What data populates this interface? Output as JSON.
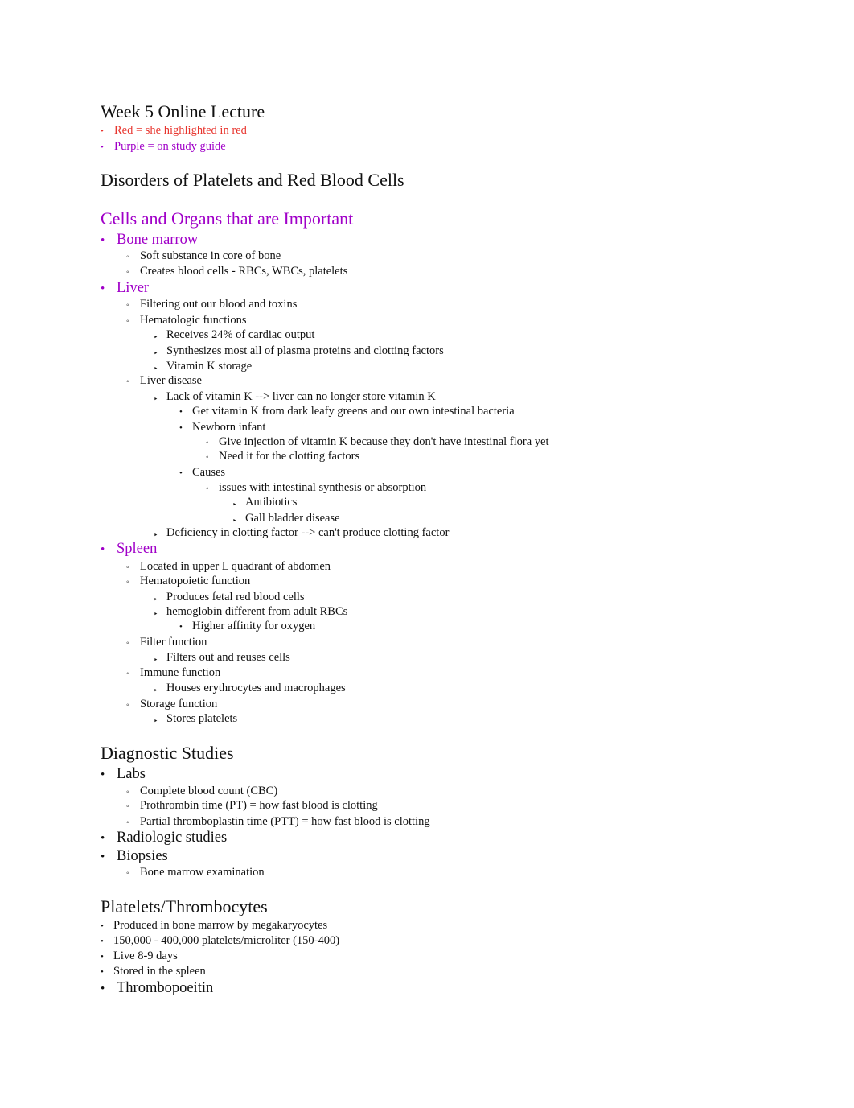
{
  "colors": {
    "red": "#e8352e",
    "purple": "#a000c8",
    "text": "#111111"
  },
  "title": "Week 5 Online Lecture",
  "legend": [
    {
      "text": "Red = she highlighted in red",
      "color": "red"
    },
    {
      "text": "Purple = on study guide",
      "color": "purple"
    }
  ],
  "section1": {
    "title": "Disorders of Platelets and Red Blood Cells"
  },
  "section2": {
    "title": "Cells and Organs that are Important",
    "lines": [
      "Bone marrow",
      "Soft substance in core of bone",
      "Creates blood cells - RBCs, WBCs, platelets",
      "Liver",
      "Filtering out our blood and toxins",
      "Hematologic functions",
      "Receives 24% of cardiac output",
      "Synthesizes most all of plasma proteins and clotting factors",
      "Vitamin K storage",
      "Liver disease",
      "Lack of vitamin K --> liver can no longer store vitamin K",
      "Get vitamin K from dark leafy greens and our own intestinal bacteria",
      "Newborn infant",
      "Give injection of vitamin K because they don't have intestinal flora yet",
      "Need it for the clotting factors",
      "Causes",
      "issues with intestinal synthesis or absorption",
      "Antibiotics",
      "Gall bladder disease",
      "Deficiency in clotting factor --> can't produce clotting factor",
      "Spleen",
      "Located in upper L quadrant of abdomen",
      "Hematopoietic function",
      "Produces fetal red blood cells",
      "hemoglobin different from adult RBCs",
      "Higher affinity for oxygen",
      "Filter function",
      "Filters out and reuses cells",
      "Immune function",
      "Houses erythrocytes and macrophages",
      "Storage function",
      "Stores platelets"
    ]
  },
  "section3": {
    "title": "Diagnostic Studies",
    "lines": [
      "Labs",
      "Complete blood count (CBC)",
      "Prothrombin time (PT) = how fast blood is clotting",
      "Partial thromboplastin time (PTT) = how fast blood is clotting",
      "Radiologic studies",
      "Biopsies",
      "Bone marrow examination"
    ]
  },
  "section4": {
    "title": "Platelets/Thrombocytes",
    "lines": [
      "Produced in bone marrow by megakaryocytes",
      "150,000 - 400,000 platelets/microliter (150-400)",
      "Live 8-9 days",
      "Stored in the spleen",
      "Thrombopoeitin"
    ]
  },
  "bullets": {
    "disc": "•",
    "circle": "◦",
    "triangle": "‣"
  }
}
